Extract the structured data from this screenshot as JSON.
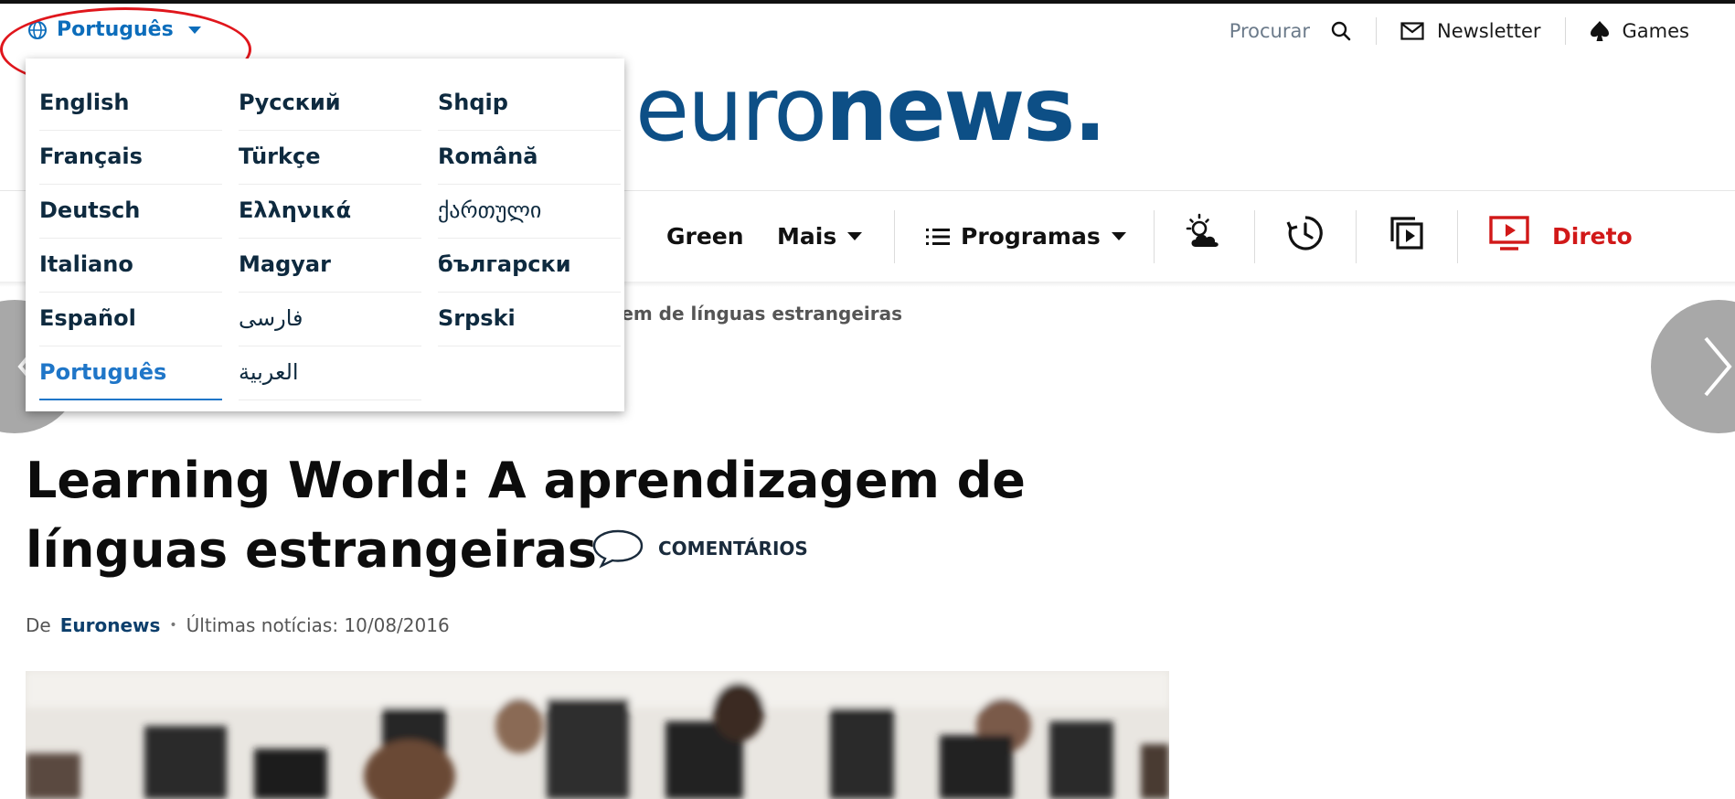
{
  "top": {
    "language_current": "Português",
    "search_label": "Procurar",
    "newsletter_label": "Newsletter",
    "games_label": "Games"
  },
  "logo": {
    "light": "euro",
    "bold": "news."
  },
  "nav": {
    "items": [
      "Green",
      "Mais",
      "Programas",
      "Direto"
    ]
  },
  "breadcrumb": "gem de línguas estrangeiras",
  "languages": [
    [
      "English",
      "Français",
      "Deutsch",
      "Italiano",
      "Español",
      "Português"
    ],
    [
      "Русский",
      "Türkçe",
      "Ελληνικά",
      "Magyar",
      "فارسی",
      "العربية"
    ],
    [
      "Shqip",
      "Română",
      "ქართული",
      "български",
      "Srpski"
    ]
  ],
  "article": {
    "title_line1": "Learning World: A aprendizagem de",
    "title_line2": "línguas estrangeiras",
    "comments_label": "COMENTÁRIOS",
    "byline_prefix": "De",
    "author": "Euronews",
    "updated": "Últimas notícias: 10/08/2016"
  },
  "colors": {
    "brand": "#0d4f86",
    "link": "#0c6dbb",
    "live": "#d11818",
    "annotation": "#e0161c"
  },
  "icons": [
    "globe-icon",
    "search-icon",
    "mail-icon",
    "spade-icon",
    "list-icon",
    "weather-icon",
    "history-icon",
    "video-playlist-icon",
    "live-tv-icon",
    "comment-icon",
    "chevron-left-icon",
    "chevron-right-icon"
  ]
}
